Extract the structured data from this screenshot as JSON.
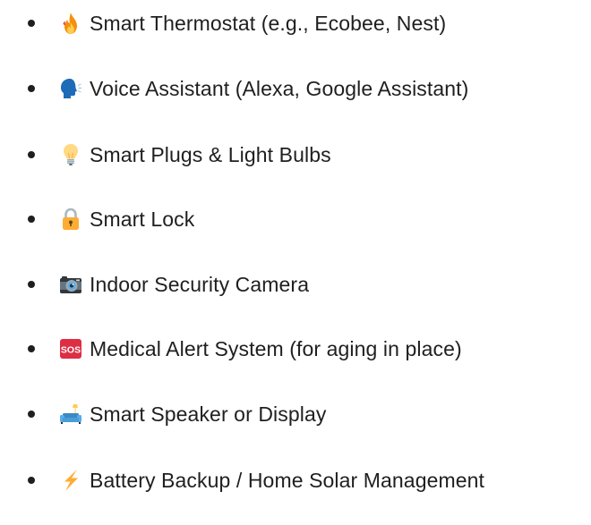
{
  "list": {
    "items": [
      {
        "icon": "fire-icon",
        "label": "Smart Thermostat (e.g., Ecobee, Nest)"
      },
      {
        "icon": "speaking-head-icon",
        "label": "Voice Assistant (Alexa, Google Assistant)"
      },
      {
        "icon": "light-bulb-icon",
        "label": "Smart Plugs & Light Bulbs"
      },
      {
        "icon": "lock-icon",
        "label": "Smart Lock"
      },
      {
        "icon": "camera-icon",
        "label": "Indoor Security Camera"
      },
      {
        "icon": "sos-icon",
        "label": "Medical Alert System (for aging in place)"
      },
      {
        "icon": "couch-lamp-icon",
        "label": "Smart Speaker or Display"
      },
      {
        "icon": "lightning-bolt-icon",
        "label": "Battery Backup / Home Solar Management"
      }
    ]
  }
}
